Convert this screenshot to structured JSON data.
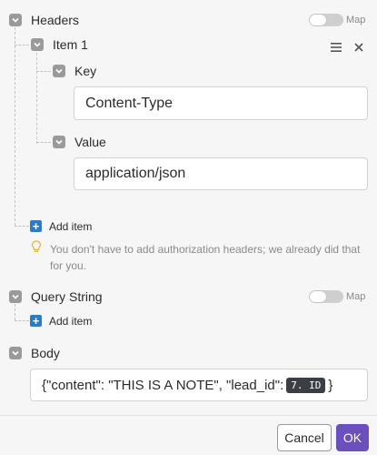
{
  "headers": {
    "label": "Headers",
    "map_label": "Map",
    "item": {
      "label": "Item 1",
      "key": {
        "label": "Key",
        "value": "Content-Type"
      },
      "value": {
        "label": "Value",
        "value": "application/json"
      }
    },
    "add_item_label": "Add item",
    "hint_line1": "You don't have to add authorization headers; we already did that",
    "hint_line2": "for you."
  },
  "query_string": {
    "label": "Query String",
    "map_label": "Map",
    "add_item_label": "Add item"
  },
  "body": {
    "label": "Body",
    "value_prefix": "{\"content\": \"THIS IS A NOTE\", \"lead_id\":",
    "token": "7. ID",
    "value_suffix": "}"
  },
  "footer": {
    "cancel_label": "Cancel",
    "ok_label": "OK"
  },
  "colors": {
    "accent": "#6b4fbb",
    "add_button": "#2b7cc1",
    "checkbox": "#9a9a9a"
  },
  "icons": {
    "menu": "hamburger-icon",
    "close": "close-icon",
    "hint": "lightbulb-icon"
  }
}
